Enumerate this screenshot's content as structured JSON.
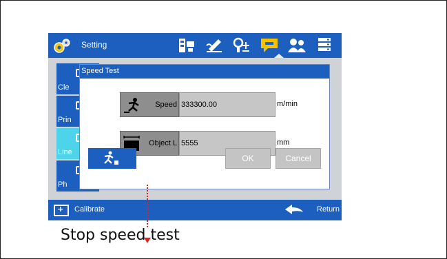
{
  "header": {
    "title": "Setting",
    "icons": [
      "settings-panel-icon",
      "edit-signature-icon",
      "user-add-icon",
      "speed-comment-icon",
      "users-icon",
      "server-list-icon"
    ],
    "active_icon": "speed-comment-icon"
  },
  "sidebar": {
    "items": [
      {
        "label": "Cle"
      },
      {
        "label": "Prin"
      },
      {
        "label": "Line",
        "selected": true
      },
      {
        "label": "Ph"
      }
    ]
  },
  "footer": {
    "calibrate_label": "Calibrate",
    "return_label": "Return"
  },
  "dialog": {
    "title": "Speed Test",
    "speed": {
      "label": "Speed",
      "value": "333300.00",
      "unit": "m/min"
    },
    "object_length": {
      "label": "Object L",
      "value": "5555",
      "unit": "mm"
    },
    "ok_label": "OK",
    "cancel_label": "Cancel"
  },
  "annotation": {
    "caption": "Stop speed test"
  },
  "colors": {
    "brand_blue": "#1d5fbf",
    "selected_cyan": "#4ed4ea",
    "highlight_yellow": "#f3c200",
    "pointer_red": "#d22222"
  }
}
